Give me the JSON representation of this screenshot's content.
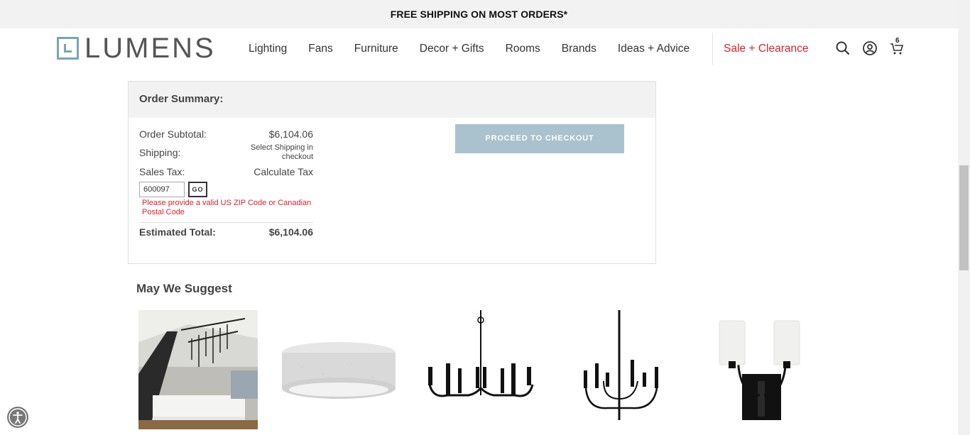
{
  "promo": {
    "text": "FREE SHIPPING ON MOST ORDERS*"
  },
  "header": {
    "logo_text": "LUMENS",
    "nav": [
      "Lighting",
      "Fans",
      "Furniture",
      "Decor + Gifts",
      "Rooms",
      "Brands",
      "Ideas + Advice"
    ],
    "sale_label": "Sale + Clearance",
    "icons": [
      "search-icon",
      "account-icon",
      "cart-icon"
    ],
    "cart_count": "6"
  },
  "order_summary": {
    "title": "Order Summary:",
    "subtotal_label": "Order Subtotal:",
    "subtotal_value": "$6,104.06",
    "shipping_label": "Shipping:",
    "shipping_value": "Select Shipping in checkout",
    "tax_label": "Sales Tax:",
    "tax_value": "Calculate Tax",
    "zip_value": "600097",
    "go_label": "GO",
    "error_text": "Please provide a valid US ZIP Code or Canadian Postal Code",
    "total_label": "Estimated Total:",
    "total_value": "$6,104.06",
    "checkout_label": "PROCEED TO CHECKOUT"
  },
  "suggest": {
    "title": "May We Suggest",
    "products": [
      "linear-chandelier-photo",
      "drum-flush-mount-image",
      "black-chandelier-image",
      "tall-chandelier-image",
      "two-light-sconce-image"
    ]
  },
  "colors": {
    "accent": "#7ba4b4",
    "sale": "#d9232d",
    "checkout": "#a9c2cd"
  }
}
